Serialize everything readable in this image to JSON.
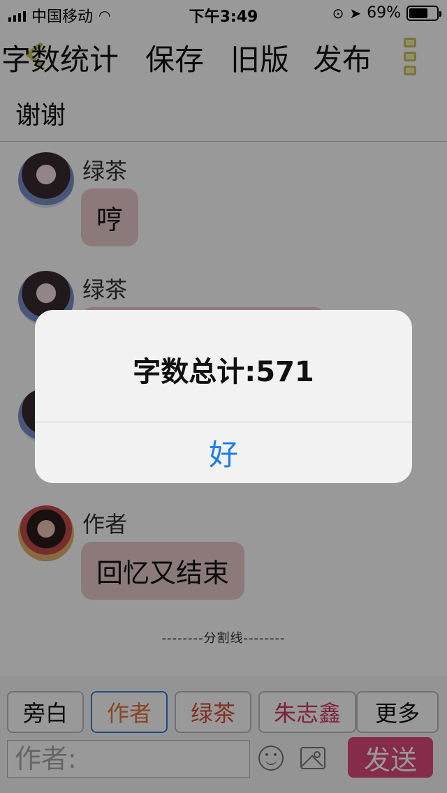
{
  "status_bar": {
    "carrier": "中国移动",
    "time": "下午3:49",
    "battery_percent": "69%",
    "battery_level": 0.69
  },
  "toolbar": {
    "word_count": "字数统计",
    "save": "保存",
    "old_version": "旧版",
    "publish": "发布"
  },
  "subtitle": "谢谢",
  "messages": [
    {
      "sender": "绿茶",
      "text": "哼"
    },
    {
      "sender": "绿茶",
      "text": ""
    },
    {
      "sender": "",
      "text": ""
    },
    {
      "sender": "作者",
      "text": "回忆又结束"
    }
  ],
  "split_line": "--------分割线--------",
  "bottom_bar": {
    "roles": [
      "旁白",
      "作者",
      "绿茶",
      "朱志鑫"
    ],
    "role_colors": [
      "#111111",
      "#e1773f",
      "#d94f3a",
      "#d43a66"
    ],
    "more": "更多",
    "input_placeholder": "作者:",
    "send": "发送"
  },
  "alert": {
    "message": "字数总计:571",
    "confirm": "好"
  },
  "colors": {
    "accent_send": "#e0487a",
    "alert_button": "#1a7ee6"
  }
}
